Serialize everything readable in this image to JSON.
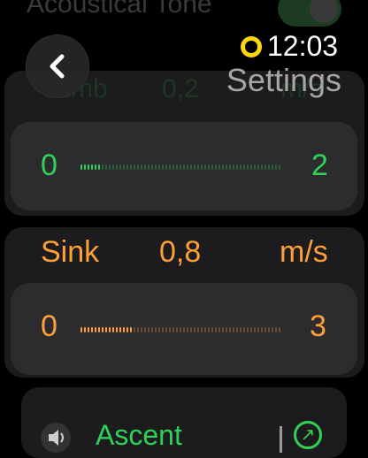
{
  "previous_row": {
    "label": "Acoustical Tone",
    "toggle_on": true
  },
  "header": {
    "time": "12:03",
    "title": "Settings",
    "accent": "#ffd60a"
  },
  "climb": {
    "label": "Climb",
    "value": "0,2",
    "unit": "m/s",
    "range_min": "0",
    "range_max": "2",
    "level_fraction": 0.1,
    "color": "#30d158"
  },
  "sink": {
    "label": "Sink",
    "value": "0,8",
    "unit": "m/s",
    "range_min": "0",
    "range_max": "3",
    "level_fraction": 0.27,
    "color": "#ff9f3a"
  },
  "sound_row": {
    "label": "Ascent",
    "icon": "speaker-icon",
    "action_icon": "open-external-icon"
  }
}
